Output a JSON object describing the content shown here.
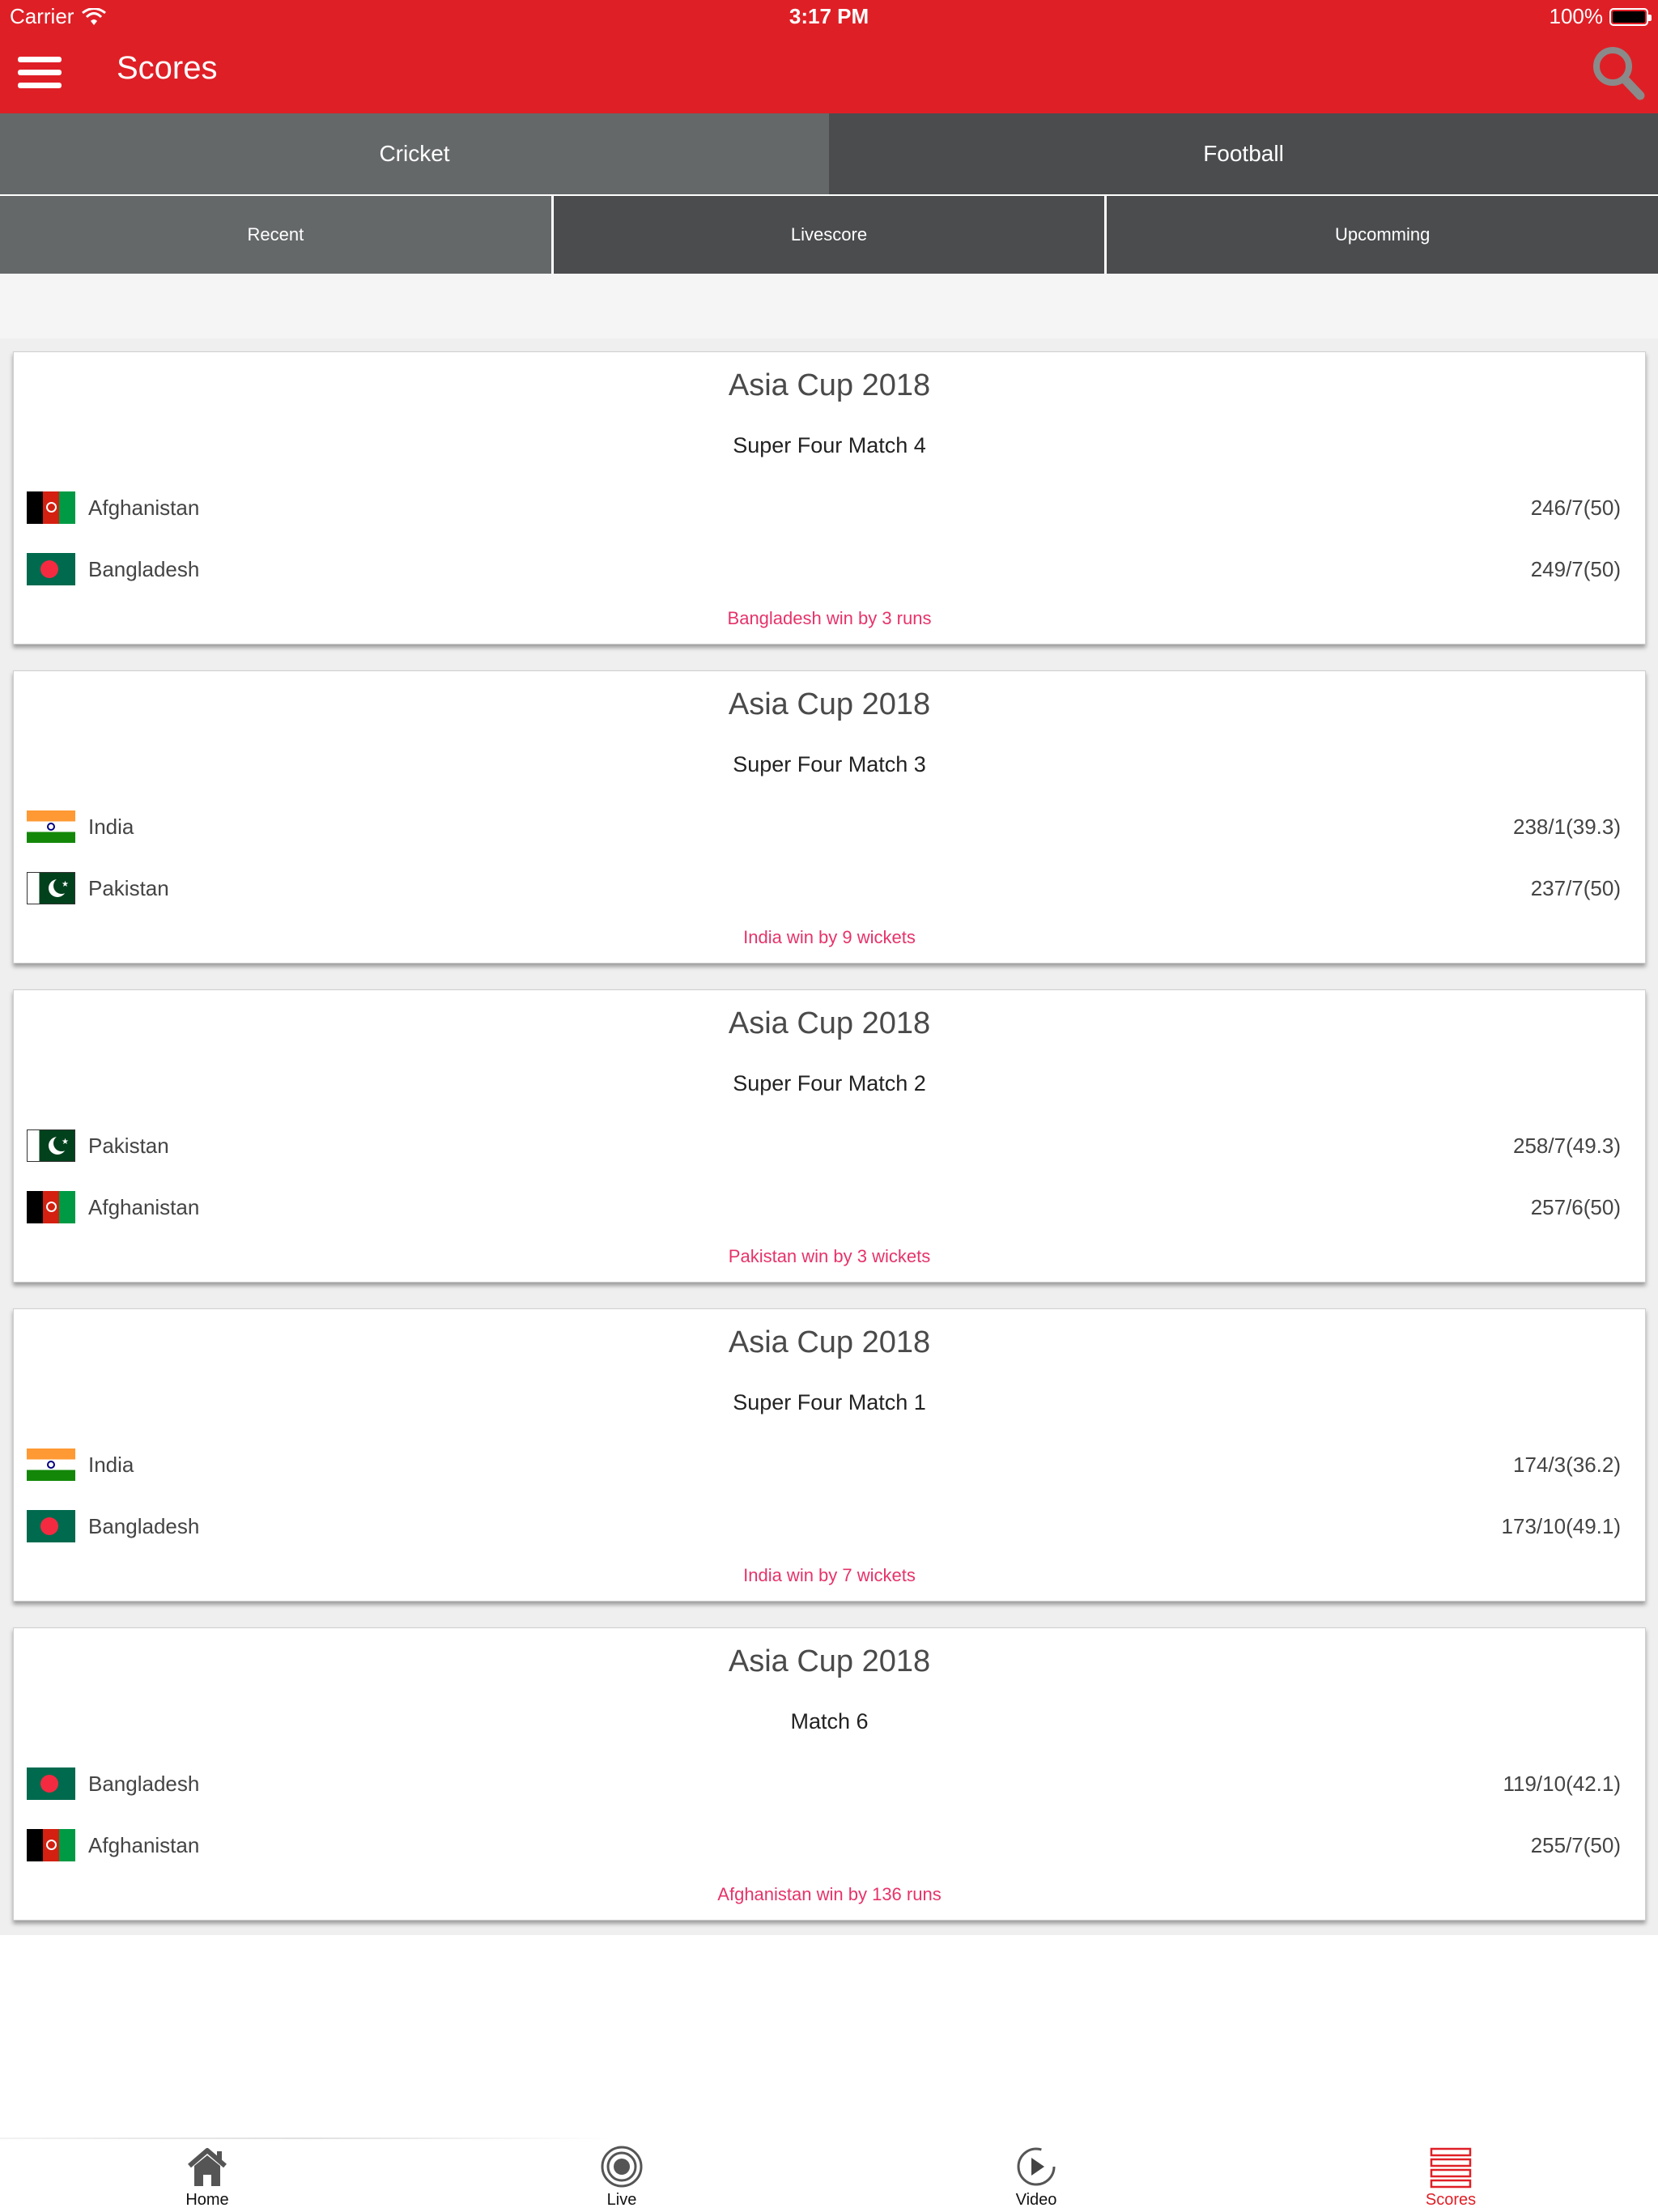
{
  "status_bar": {
    "carrier": "Carrier",
    "time": "3:17 PM",
    "battery": "100%"
  },
  "nav": {
    "title": "Scores",
    "menu_icon": "hamburger-menu-icon",
    "search_icon": "search-icon"
  },
  "sport_tabs": [
    {
      "label": "Cricket",
      "active": true
    },
    {
      "label": "Football",
      "active": false
    }
  ],
  "sub_tabs": [
    {
      "label": "Recent",
      "active": true
    },
    {
      "label": "Livescore",
      "active": false
    },
    {
      "label": "Upcomming",
      "active": false
    }
  ],
  "matches": [
    {
      "tournament": "Asia Cup 2018",
      "match_name": "Super Four Match 4",
      "team1": {
        "name": "Afghanistan",
        "flag": "afghanistan-flag",
        "score": "246/7(50)"
      },
      "team2": {
        "name": "Bangladesh",
        "flag": "bangladesh-flag",
        "score": "249/7(50)"
      },
      "result": "Bangladesh win by 3 runs"
    },
    {
      "tournament": "Asia Cup 2018",
      "match_name": "Super Four Match 3",
      "team1": {
        "name": "India",
        "flag": "india-flag",
        "score": "238/1(39.3)"
      },
      "team2": {
        "name": "Pakistan",
        "flag": "pakistan-flag",
        "score": "237/7(50)"
      },
      "result": "India win by 9 wickets"
    },
    {
      "tournament": "Asia Cup 2018",
      "match_name": "Super Four Match 2",
      "team1": {
        "name": "Pakistan",
        "flag": "pakistan-flag",
        "score": "258/7(49.3)"
      },
      "team2": {
        "name": "Afghanistan",
        "flag": "afghanistan-flag",
        "score": "257/6(50)"
      },
      "result": "Pakistan win by 3 wickets"
    },
    {
      "tournament": "Asia Cup 2018",
      "match_name": "Super Four Match 1",
      "team1": {
        "name": "India",
        "flag": "india-flag",
        "score": "174/3(36.2)"
      },
      "team2": {
        "name": "Bangladesh",
        "flag": "bangladesh-flag",
        "score": "173/10(49.1)"
      },
      "result": "India win by 7 wickets"
    },
    {
      "tournament": "Asia Cup 2018",
      "match_name": "Match 6",
      "team1": {
        "name": "Bangladesh",
        "flag": "bangladesh-flag",
        "score": "119/10(42.1)"
      },
      "team2": {
        "name": "Afghanistan",
        "flag": "afghanistan-flag",
        "score": "255/7(50)"
      },
      "result": "Afghanistan win by 136 runs"
    }
  ],
  "tab_bar": [
    {
      "label": "Home",
      "icon": "home-icon",
      "selected": false
    },
    {
      "label": "Live",
      "icon": "live-icon",
      "selected": false
    },
    {
      "label": "Video",
      "icon": "play-icon",
      "selected": false
    },
    {
      "label": "Scores",
      "icon": "scores-list-icon",
      "selected": true
    }
  ],
  "colors": {
    "brand_red": "#df1f26",
    "tab_active": "#656869",
    "tab_inactive": "#4b4c4e",
    "result_pink": "#e6336a"
  }
}
